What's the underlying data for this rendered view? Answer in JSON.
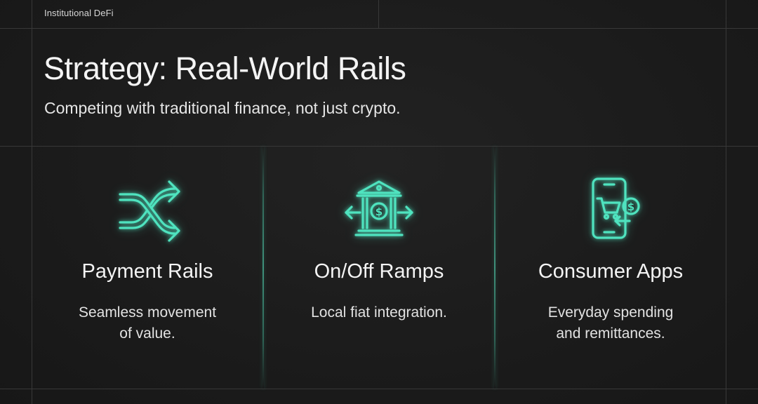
{
  "header": {
    "eyebrow": "Institutional DeFi",
    "title": "Strategy: Real-World Rails",
    "subtitle": "Competing with traditional finance, not just crypto."
  },
  "columns": [
    {
      "icon": "shuffle-arrows-icon",
      "title": "Payment Rails",
      "description_lines": [
        "Seamless movement",
        "of value."
      ]
    },
    {
      "icon": "bank-exchange-icon",
      "title": "On/Off Ramps",
      "description_lines": [
        "Local fiat integration."
      ]
    },
    {
      "icon": "phone-cart-dollar-icon",
      "title": "Consumer Apps",
      "description_lines": [
        "Everyday spending",
        "and remittances."
      ]
    }
  ],
  "colors": {
    "background": "#1b1b1b",
    "accent": "#4fe3bf",
    "grid_line": "#383838",
    "text": "#f4f4f4"
  }
}
